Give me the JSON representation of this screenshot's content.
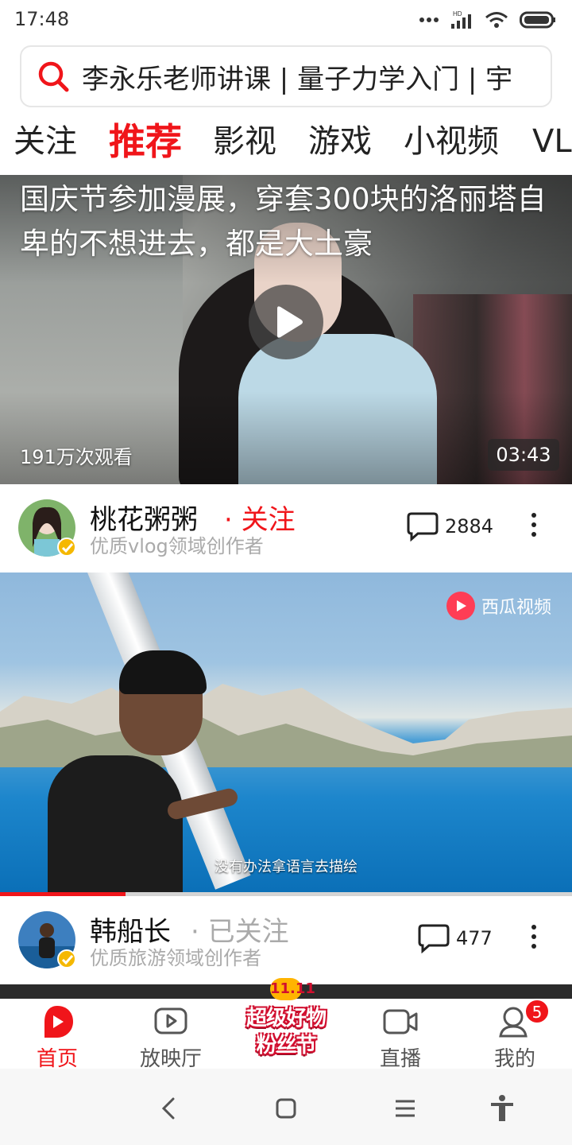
{
  "status_bar": {
    "time": "17:48",
    "network_label": "HD"
  },
  "search": {
    "query": "李永乐老师讲课 | 量子力学入门 | 宇"
  },
  "tabs": [
    {
      "label": "关注",
      "active": false
    },
    {
      "label": "推荐",
      "active": true
    },
    {
      "label": "影视",
      "active": false
    },
    {
      "label": "游戏",
      "active": false
    },
    {
      "label": "小视频",
      "active": false
    },
    {
      "label": "VL",
      "active": false
    }
  ],
  "feed": [
    {
      "title": "国庆节参加漫展，穿套300块的洛丽塔自卑的不想进去，都是大土豪",
      "views": "191万次观看",
      "duration": "03:43",
      "author": "桃花粥粥",
      "follow_label": "关注",
      "author_desc": "优质vlog领域创作者",
      "comments": "2884"
    },
    {
      "watermark": "西瓜视频",
      "subtitle": "没有办法拿语言去描绘",
      "progress": 0.22,
      "author": "韩船长",
      "follow_label": "已关注",
      "author_desc": "优质旅游领域创作者",
      "comments": "477"
    }
  ],
  "bottom_nav": {
    "items": [
      {
        "label": "首页",
        "icon": "home-play-icon",
        "active": true
      },
      {
        "label": "放映厅",
        "icon": "theater-icon",
        "active": false
      },
      {
        "label": "直播",
        "icon": "live-camera-icon",
        "active": false
      },
      {
        "label": "我的",
        "icon": "profile-icon",
        "active": false
      }
    ],
    "profile_badge": "5",
    "promo": {
      "top": "11.11",
      "line1": "超级好物",
      "line2": "粉丝节"
    }
  },
  "colors": {
    "accent": "#f0151a",
    "text": "#222222",
    "muted": "#aaaaaa"
  }
}
